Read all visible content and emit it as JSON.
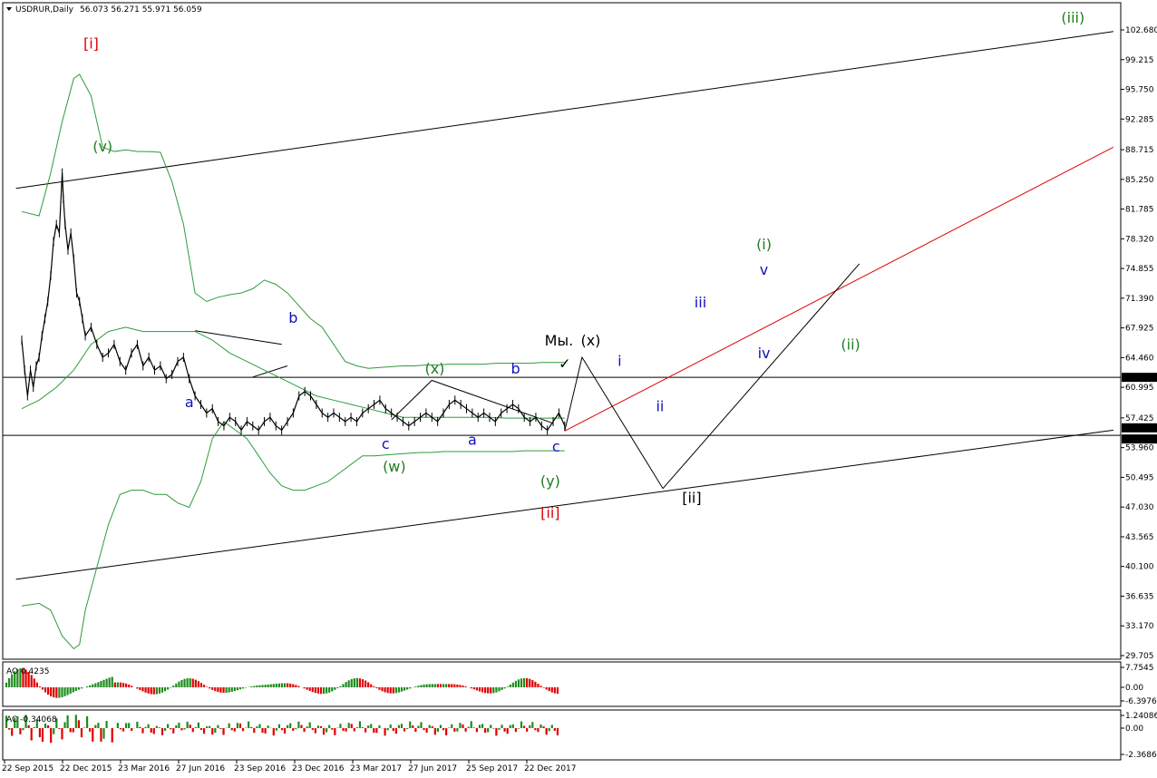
{
  "chart_data": {
    "type": "line",
    "title": "USDRUR,Daily",
    "ohlc": "56.073 56.271 55.971 56.059",
    "ylim": [
      28.5,
      105.2
    ],
    "grid": false,
    "price_ticks": [
      "102.680",
      "99.215",
      "95.750",
      "92.285",
      "88.715",
      "85.250",
      "81.785",
      "78.320",
      "74.855",
      "71.390",
      "67.925",
      "64.460",
      "60.995",
      "57.425",
      "53.960",
      "50.495",
      "47.030",
      "43.565",
      "40.100",
      "36.635",
      "33.170",
      "29.705"
    ],
    "price_tick_values": [
      102.68,
      99.215,
      95.75,
      92.285,
      88.715,
      85.25,
      81.785,
      78.32,
      74.855,
      71.39,
      67.925,
      64.46,
      60.995,
      57.425,
      53.96,
      50.495,
      47.03,
      43.565,
      40.1,
      36.635,
      33.17,
      29.705
    ],
    "date_labels": [
      "22 Sep 2015",
      "22 Dec 2015",
      "23 Mar 2016",
      "27 Jun 2016",
      "23 Sep 2016",
      "23 Dec 2016",
      "23 Mar 2017",
      "27 Jun 2017",
      "25 Sep 2017",
      "22 Dec 2017"
    ],
    "date_label_index": [
      0,
      1,
      2,
      3,
      4,
      5,
      6,
      7,
      8,
      9
    ],
    "price_markers": [
      {
        "label": "62.158",
        "value": 62.158,
        "bg": "#000000",
        "fg": "#ffffff"
      },
      {
        "label": "56.059",
        "value": 56.059,
        "bg": "#000000",
        "fg": "#ffffff"
      },
      {
        "label": "55.388",
        "value": 55.388,
        "bg": "#000000",
        "fg": "#ffffff"
      }
    ],
    "horizontal_levels": [
      62.158,
      55.388
    ],
    "price_series": [
      [
        0,
        66.5
      ],
      [
        0.05,
        63
      ],
      [
        0.1,
        60
      ],
      [
        0.15,
        63
      ],
      [
        0.2,
        61
      ],
      [
        0.25,
        63.5
      ],
      [
        0.3,
        64.5
      ],
      [
        0.35,
        67
      ],
      [
        0.4,
        69
      ],
      [
        0.45,
        71
      ],
      [
        0.5,
        74
      ],
      [
        0.55,
        78
      ],
      [
        0.6,
        80
      ],
      [
        0.65,
        79
      ],
      [
        0.7,
        86
      ],
      [
        0.72,
        83
      ],
      [
        0.75,
        80
      ],
      [
        0.8,
        77
      ],
      [
        0.85,
        79
      ],
      [
        0.9,
        76
      ],
      [
        0.95,
        72
      ],
      [
        1.0,
        71
      ],
      [
        1.05,
        69
      ],
      [
        1.1,
        67
      ],
      [
        1.2,
        68
      ],
      [
        1.3,
        66
      ],
      [
        1.4,
        64.5
      ],
      [
        1.5,
        65
      ],
      [
        1.6,
        66
      ],
      [
        1.7,
        64
      ],
      [
        1.8,
        63
      ],
      [
        1.9,
        65
      ],
      [
        2.0,
        66
      ],
      [
        2.1,
        63.5
      ],
      [
        2.2,
        64.5
      ],
      [
        2.3,
        63
      ],
      [
        2.4,
        63.5
      ],
      [
        2.5,
        62
      ],
      [
        2.6,
        62.5
      ],
      [
        2.7,
        64
      ],
      [
        2.8,
        64.5
      ],
      [
        2.9,
        62
      ],
      [
        3.0,
        60
      ],
      [
        3.1,
        59
      ],
      [
        3.2,
        58
      ],
      [
        3.3,
        58.5
      ],
      [
        3.4,
        57
      ],
      [
        3.5,
        56.5
      ],
      [
        3.6,
        57.5
      ],
      [
        3.7,
        57
      ],
      [
        3.8,
        56
      ],
      [
        3.9,
        57
      ],
      [
        4.0,
        56.5
      ],
      [
        4.1,
        56
      ],
      [
        4.2,
        57
      ],
      [
        4.3,
        57.5
      ],
      [
        4.4,
        56.5
      ],
      [
        4.5,
        56
      ],
      [
        4.6,
        57
      ],
      [
        4.7,
        58
      ],
      [
        4.8,
        60
      ],
      [
        4.9,
        60.5
      ],
      [
        5.0,
        60
      ],
      [
        5.1,
        59
      ],
      [
        5.2,
        58
      ],
      [
        5.3,
        57.5
      ],
      [
        5.4,
        58
      ],
      [
        5.5,
        57.5
      ],
      [
        5.6,
        57
      ],
      [
        5.7,
        57.5
      ],
      [
        5.8,
        57
      ],
      [
        5.9,
        58
      ],
      [
        6.0,
        58.5
      ],
      [
        6.1,
        59
      ],
      [
        6.2,
        59.5
      ],
      [
        6.3,
        58.5
      ],
      [
        6.4,
        58
      ],
      [
        6.5,
        57.5
      ],
      [
        6.6,
        57
      ],
      [
        6.7,
        56.5
      ],
      [
        6.8,
        57
      ],
      [
        6.9,
        57.5
      ],
      [
        7.0,
        58
      ],
      [
        7.1,
        57.5
      ],
      [
        7.2,
        57
      ],
      [
        7.3,
        58
      ],
      [
        7.4,
        59
      ],
      [
        7.5,
        59.5
      ],
      [
        7.6,
        59
      ],
      [
        7.7,
        58.5
      ],
      [
        7.8,
        58
      ],
      [
        7.9,
        57.5
      ],
      [
        8.0,
        58
      ],
      [
        8.1,
        57.5
      ],
      [
        8.2,
        57
      ],
      [
        8.3,
        58
      ],
      [
        8.4,
        58.5
      ],
      [
        8.5,
        59
      ],
      [
        8.6,
        58.5
      ],
      [
        8.7,
        57.5
      ],
      [
        8.8,
        57
      ],
      [
        8.9,
        57.5
      ],
      [
        9.0,
        56.5
      ],
      [
        9.1,
        56
      ],
      [
        9.2,
        57
      ],
      [
        9.3,
        58
      ],
      [
        9.4,
        56.5
      ]
    ],
    "bands": {
      "upper": [
        [
          0,
          81.5
        ],
        [
          0.3,
          81
        ],
        [
          0.5,
          86
        ],
        [
          0.7,
          92
        ],
        [
          0.9,
          97
        ],
        [
          1.0,
          97.5
        ],
        [
          1.2,
          95
        ],
        [
          1.4,
          89
        ],
        [
          1.6,
          88.5
        ],
        [
          1.8,
          88.7
        ],
        [
          2.0,
          88.5
        ],
        [
          2.2,
          88.5
        ],
        [
          2.4,
          88.4
        ],
        [
          2.6,
          85
        ],
        [
          2.8,
          80
        ],
        [
          3.0,
          72
        ],
        [
          3.2,
          71
        ],
        [
          3.4,
          71.5
        ],
        [
          3.6,
          71.8
        ],
        [
          3.8,
          72
        ],
        [
          4.0,
          72.5
        ],
        [
          4.2,
          73.5
        ],
        [
          4.4,
          73
        ],
        [
          4.6,
          72
        ],
        [
          4.8,
          70.5
        ],
        [
          5.0,
          69
        ],
        [
          5.2,
          68
        ],
        [
          5.4,
          66
        ],
        [
          5.6,
          64
        ],
        [
          5.8,
          63.5
        ],
        [
          6.0,
          63.2
        ],
        [
          6.2,
          63.3
        ],
        [
          6.4,
          63.4
        ],
        [
          6.6,
          63.5
        ],
        [
          6.8,
          63.5
        ],
        [
          7.0,
          63.6
        ],
        [
          7.2,
          63.6
        ],
        [
          7.4,
          63.7
        ],
        [
          7.6,
          63.7
        ],
        [
          7.8,
          63.7
        ],
        [
          8.0,
          63.7
        ],
        [
          8.2,
          63.8
        ],
        [
          8.4,
          63.8
        ],
        [
          8.6,
          63.8
        ],
        [
          8.8,
          63.8
        ],
        [
          9.0,
          63.9
        ],
        [
          9.2,
          63.9
        ],
        [
          9.4,
          63.9
        ]
      ],
      "middle": [
        [
          0,
          58.5
        ],
        [
          0.3,
          59.5
        ],
        [
          0.6,
          61
        ],
        [
          0.9,
          63
        ],
        [
          1.2,
          66
        ],
        [
          1.5,
          67.5
        ],
        [
          1.8,
          68
        ],
        [
          2.1,
          67.5
        ],
        [
          2.4,
          67.5
        ],
        [
          2.7,
          67.5
        ],
        [
          3.0,
          67.5
        ],
        [
          3.3,
          66.5
        ],
        [
          3.6,
          65
        ],
        [
          3.9,
          64
        ],
        [
          4.2,
          63
        ],
        [
          4.5,
          62
        ],
        [
          4.8,
          61
        ],
        [
          5.1,
          60
        ],
        [
          5.4,
          59.5
        ],
        [
          5.7,
          59
        ],
        [
          6.0,
          58.5
        ],
        [
          6.3,
          58
        ],
        [
          6.6,
          57.5
        ],
        [
          6.9,
          57.5
        ],
        [
          7.2,
          57.5
        ],
        [
          7.5,
          57.5
        ],
        [
          7.8,
          57.5
        ],
        [
          8.1,
          57.5
        ],
        [
          8.4,
          57.4
        ],
        [
          8.7,
          57.4
        ],
        [
          9.0,
          57.4
        ],
        [
          9.4,
          57.4
        ]
      ],
      "lower": [
        [
          0,
          35.5
        ],
        [
          0.3,
          35.8
        ],
        [
          0.5,
          35
        ],
        [
          0.7,
          32
        ],
        [
          0.9,
          30.5
        ],
        [
          1.0,
          31
        ],
        [
          1.1,
          35
        ],
        [
          1.3,
          40
        ],
        [
          1.5,
          45
        ],
        [
          1.7,
          48.5
        ],
        [
          1.9,
          49
        ],
        [
          2.1,
          49
        ],
        [
          2.3,
          48.5
        ],
        [
          2.5,
          48.5
        ],
        [
          2.7,
          47.5
        ],
        [
          2.9,
          47
        ],
        [
          3.1,
          50
        ],
        [
          3.3,
          55
        ],
        [
          3.5,
          57
        ],
        [
          3.7,
          56
        ],
        [
          3.9,
          55
        ],
        [
          4.1,
          53
        ],
        [
          4.3,
          51
        ],
        [
          4.5,
          49.5
        ],
        [
          4.7,
          49
        ],
        [
          4.9,
          49
        ],
        [
          5.1,
          49.5
        ],
        [
          5.3,
          50
        ],
        [
          5.5,
          51
        ],
        [
          5.7,
          52
        ],
        [
          5.9,
          53
        ],
        [
          6.1,
          53
        ],
        [
          6.3,
          53.1
        ],
        [
          6.5,
          53.2
        ],
        [
          6.7,
          53.3
        ],
        [
          6.9,
          53.4
        ],
        [
          7.1,
          53.4
        ],
        [
          7.3,
          53.5
        ],
        [
          7.5,
          53.5
        ],
        [
          7.7,
          53.5
        ],
        [
          7.9,
          53.5
        ],
        [
          8.1,
          53.5
        ],
        [
          8.3,
          53.5
        ],
        [
          8.5,
          53.5
        ],
        [
          8.7,
          53.6
        ],
        [
          8.9,
          53.6
        ],
        [
          9.1,
          53.6
        ],
        [
          9.4,
          53.6
        ]
      ]
    },
    "projection": [
      [
        9.4,
        55.9
      ],
      [
        9.7,
        64.5
      ],
      [
        11.1,
        49.2
      ],
      [
        14.5,
        75.4
      ]
    ],
    "red_channel": [
      [
        9.4,
        55.9
      ],
      [
        18.9,
        89
      ]
    ],
    "channel_top": [
      [
        -0.1,
        84.2
      ],
      [
        18.9,
        102.5
      ]
    ],
    "channel_bottom": [
      [
        -0.1,
        38.6
      ],
      [
        18.9,
        56
      ]
    ],
    "small_lines": [
      [
        [
          3.0,
          67.6
        ],
        [
          4.5,
          66
        ]
      ],
      [
        [
          4.0,
          62.2
        ],
        [
          4.6,
          63.5
        ]
      ],
      [
        [
          6.4,
          57.2
        ],
        [
          7.1,
          61.8
        ],
        [
          9.2,
          56.8
        ]
      ]
    ],
    "labels": [
      {
        "text": "[i]",
        "color": "#e00000",
        "x": 1.2,
        "y": 100.5
      },
      {
        "text": "(v)",
        "color": "#1e7d1e",
        "x": 1.4,
        "y": 88.5
      },
      {
        "text": "a",
        "color": "#1010c0",
        "x": 2.9,
        "y": 58.7
      },
      {
        "text": "b",
        "color": "#1010c0",
        "x": 4.7,
        "y": 68.5
      },
      {
        "text": "c",
        "color": "#1010c0",
        "x": 6.3,
        "y": 53.8
      },
      {
        "text": "(w)",
        "color": "#1e7d1e",
        "x": 6.45,
        "y": 51.2
      },
      {
        "text": "(x)",
        "color": "#1e7d1e",
        "x": 7.15,
        "y": 62.6
      },
      {
        "text": "a",
        "color": "#1010c0",
        "x": 7.8,
        "y": 54.3
      },
      {
        "text": "b",
        "color": "#1010c0",
        "x": 8.55,
        "y": 62.6
      },
      {
        "text": "c",
        "color": "#1010c0",
        "x": 9.25,
        "y": 53.5
      },
      {
        "text": "(y)",
        "color": "#1e7d1e",
        "x": 9.15,
        "y": 49.5
      },
      {
        "text": "[ii]",
        "color": "#e00000",
        "x": 9.15,
        "y": 45.8
      },
      {
        "text": "Мы.",
        "color": "#000000",
        "x": 9.3,
        "y": 65.9
      },
      {
        "text": "(x)",
        "color": "#000000",
        "x": 9.85,
        "y": 65.9
      },
      {
        "text": "✓",
        "color": "#000000",
        "x": 9.4,
        "y": 63.2
      },
      {
        "text": "i",
        "color": "#1010c0",
        "x": 10.35,
        "y": 63.5
      },
      {
        "text": "ii",
        "color": "#1010c0",
        "x": 11.05,
        "y": 58.2
      },
      {
        "text": "[ii]",
        "color": "#000000",
        "x": 11.6,
        "y": 47.5
      },
      {
        "text": "iii",
        "color": "#1010c0",
        "x": 11.75,
        "y": 70.3
      },
      {
        "text": "iv",
        "color": "#1010c0",
        "x": 12.85,
        "y": 64.4
      },
      {
        "text": "v",
        "color": "#1010c0",
        "x": 12.85,
        "y": 74.1
      },
      {
        "text": "(i)",
        "color": "#1e7d1e",
        "x": 12.85,
        "y": 77.1
      },
      {
        "text": "(ii)",
        "color": "#1e7d1e",
        "x": 14.35,
        "y": 65.4
      },
      {
        "text": "(iii)",
        "color": "#1e7d1e",
        "x": 18.2,
        "y": 103.5
      }
    ]
  },
  "ao_panel": {
    "label": "AO 0.4235",
    "ticks": [
      "7.7545",
      "0.00",
      "-6.3976"
    ],
    "tick_values": [
      7.7545,
      0,
      -6.3976
    ]
  },
  "ac_panel": {
    "label": "AC -0.34068",
    "ticks": [
      "1.24086",
      "0.00",
      "-2.36862"
    ],
    "tick_values": [
      1.24086,
      0,
      -2.36862
    ]
  },
  "colors": {
    "up": "#1e8c1e",
    "down": "#e00000",
    "band": "#2d9c3a",
    "red_line": "#e00000"
  }
}
